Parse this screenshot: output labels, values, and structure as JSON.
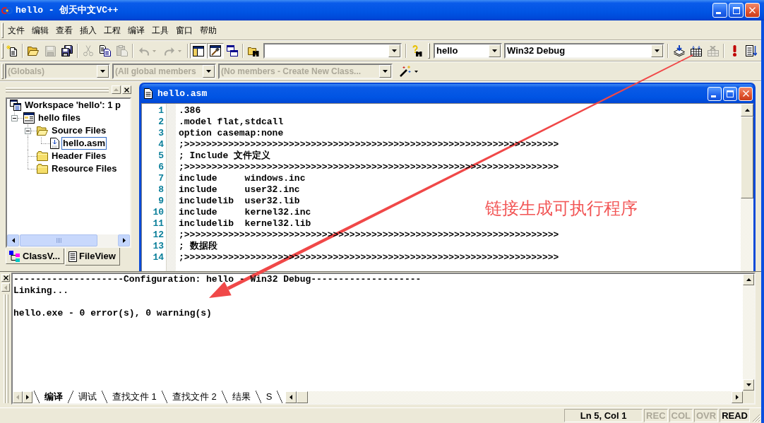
{
  "window": {
    "title": "hello - 创天中文VC++"
  },
  "menu_bar": [
    "文件",
    "编辑",
    "查看",
    "插入",
    "工程",
    "编译",
    "工具",
    "窗口",
    "帮助"
  ],
  "standard_toolbar": {
    "buttons": [
      {
        "disabled": false,
        "pressed": false
      },
      {
        "disabled": false,
        "pressed": false
      },
      {
        "disabled": true,
        "pressed": false
      },
      {
        "disabled": false,
        "pressed": false
      },
      {
        "disabled": true,
        "pressed": false
      },
      {
        "disabled": false,
        "pressed": false
      },
      {
        "disabled": true,
        "pressed": false
      },
      {
        "disabled": true,
        "pressed": false
      },
      {
        "disabled": true,
        "pressed": false
      },
      {
        "disabled": false,
        "pressed": true
      },
      {
        "disabled": false,
        "pressed": true
      },
      {
        "disabled": false,
        "pressed": false
      },
      {
        "disabled": false,
        "pressed": false
      },
      {
        "disabled": false,
        "pressed": false
      }
    ]
  },
  "build_toolbar": {
    "project": "hello",
    "configuration": "Win32 Debug",
    "buttons": [
      {
        "disabled": false
      },
      {
        "disabled": false
      },
      {
        "disabled": true
      },
      {
        "disabled": false
      },
      {
        "disabled": false
      }
    ]
  },
  "wizard_bar": {
    "combos": [
      {
        "value": "(Globals)",
        "disabled": true
      },
      {
        "value": "(All global members",
        "disabled": true
      },
      {
        "value": "(No members - Create New Class...",
        "disabled": true
      }
    ]
  },
  "workspace": {
    "tree": [
      {
        "kind": "workspace",
        "label": "Workspace 'hello': 1 p",
        "selected": false,
        "children": [
          {
            "kind": "project",
            "label": "hello files",
            "expanded": true,
            "selected": false,
            "children": [
              {
                "kind": "folder",
                "label": "Source Files",
                "expanded": true,
                "selected": false,
                "children": [
                  {
                    "kind": "file",
                    "label": "hello.asm",
                    "selected": true
                  }
                ]
              },
              {
                "kind": "folder",
                "label": "Header Files",
                "selected": false
              },
              {
                "kind": "folder",
                "label": "Resource Files",
                "selected": false
              }
            ]
          }
        ]
      }
    ],
    "tabs": [
      {
        "label": "ClassV...",
        "selected": false
      },
      {
        "label": "FileView",
        "selected": true
      }
    ]
  },
  "editor": {
    "title": "hello.asm",
    "lines": [
      {
        "number": "1",
        "text": ".386"
      },
      {
        "number": "2",
        "text": ".model flat,stdcall"
      },
      {
        "number": "3",
        "text": "option casemap:none"
      },
      {
        "number": "4",
        "text": ";>>>>>>>>>>>>>>>>>>>>>>>>>>>>>>>>>>>>>>>>>>>>>>>>>>>>>>>>>>>>>>>>>>>>"
      },
      {
        "number": "5",
        "text": "; Include 文件定义"
      },
      {
        "number": "6",
        "text": ";>>>>>>>>>>>>>>>>>>>>>>>>>>>>>>>>>>>>>>>>>>>>>>>>>>>>>>>>>>>>>>>>>>>>"
      },
      {
        "number": "7",
        "text": "include     windows.inc"
      },
      {
        "number": "8",
        "text": "include     user32.inc"
      },
      {
        "number": "9",
        "text": "includelib  user32.lib"
      },
      {
        "number": "10",
        "text": "include     kernel32.inc"
      },
      {
        "number": "11",
        "text": "includelib  kernel32.lib"
      },
      {
        "number": "12",
        "text": ";>>>>>>>>>>>>>>>>>>>>>>>>>>>>>>>>>>>>>>>>>>>>>>>>>>>>>>>>>>>>>>>>>>>>"
      },
      {
        "number": "13",
        "text": "; 数据段"
      },
      {
        "number": "14",
        "text": ";>>>>>>>>>>>>>>>>>>>>>>>>>>>>>>>>>>>>>>>>>>>>>>>>>>>>>>>>>>>>>>>>>>>>"
      }
    ]
  },
  "output": {
    "messages": [
      "--------------------Configuration: hello - Win32 Debug--------------------",
      "Linking..."
    ],
    "summary": "hello.exe - 0 error(s), 0 warning(s)",
    "tabs": [
      {
        "label": "编译",
        "selected": true
      },
      {
        "label": "调试",
        "selected": false
      },
      {
        "label": "查找文件 1",
        "selected": false
      },
      {
        "label": "查找文件 2",
        "selected": false
      },
      {
        "label": "结果",
        "selected": false
      },
      {
        "label": "S",
        "selected": false
      }
    ]
  },
  "status_bar": {
    "position": "Ln 5, Col 1",
    "indicators": [
      {
        "label": "REC",
        "on": false
      },
      {
        "label": "COL",
        "on": false
      },
      {
        "label": "OVR",
        "on": false
      },
      {
        "label": "READ",
        "on": true
      }
    ]
  },
  "annotation": {
    "text": "链接生成可执行程序"
  }
}
